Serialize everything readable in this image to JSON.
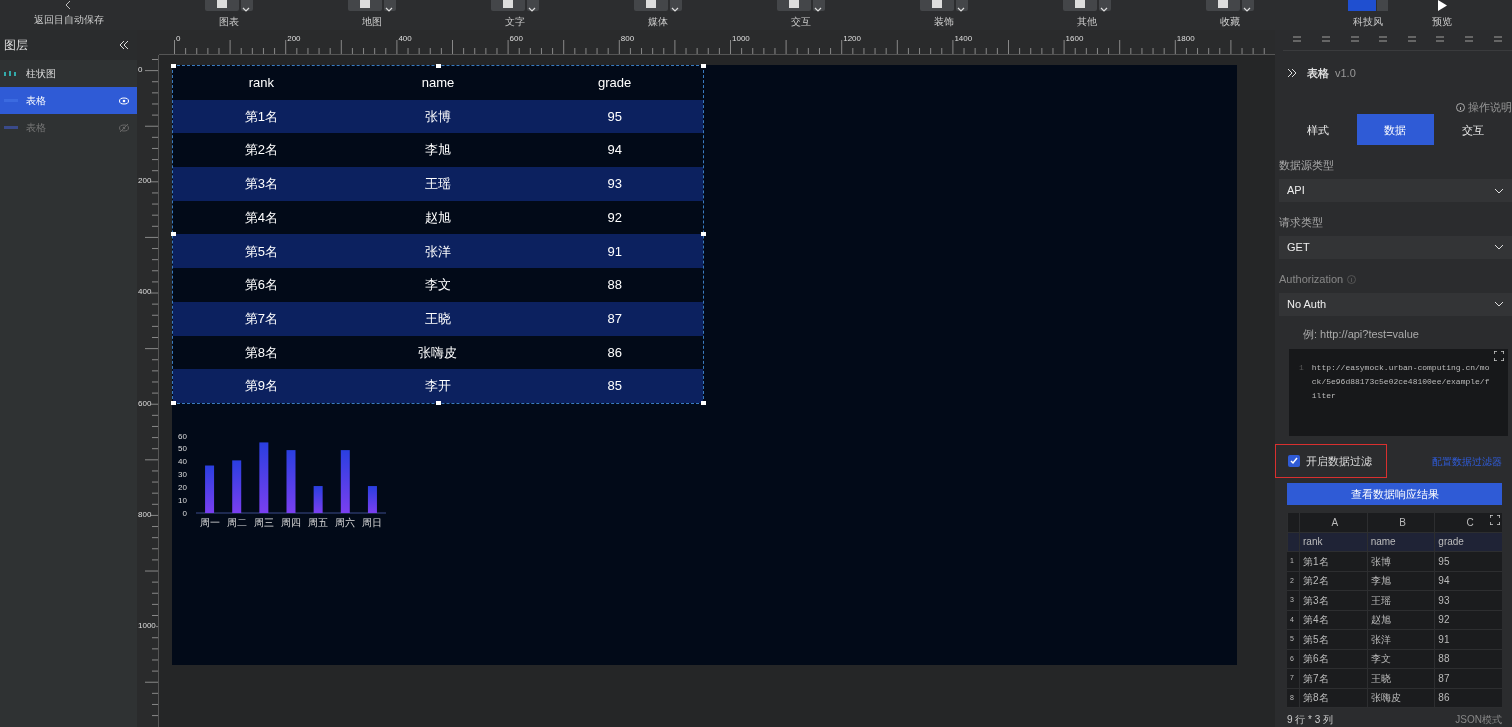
{
  "toolbar": {
    "back_label": "返回目自动保存",
    "tools": [
      {
        "label": "图表"
      },
      {
        "label": "地图"
      },
      {
        "label": "文字"
      },
      {
        "label": "媒体"
      },
      {
        "label": "交互"
      },
      {
        "label": "装饰"
      },
      {
        "label": "其他"
      },
      {
        "label": "收藏"
      }
    ],
    "theme": {
      "label": "科技风"
    },
    "preview": {
      "label": "预览"
    }
  },
  "layers": {
    "title": "图层",
    "items": [
      {
        "label": "柱状图",
        "kind": "bar",
        "selected": false,
        "hidden": false
      },
      {
        "label": "表格",
        "kind": "table",
        "selected": true,
        "hidden": false
      },
      {
        "label": "表格",
        "kind": "table",
        "selected": false,
        "hidden": true
      }
    ]
  },
  "rulers": {
    "x_labels": [
      "0",
      "200",
      "400",
      "600",
      "800",
      "1000",
      "1200",
      "1400",
      "1600",
      "1800"
    ],
    "y_labels": [
      "0",
      "200",
      "400",
      "600",
      "800",
      "1000"
    ]
  },
  "table": {
    "columns": [
      "rank",
      "name",
      "grade"
    ],
    "rows": [
      [
        "第1名",
        "张博",
        "95"
      ],
      [
        "第2名",
        "李旭",
        "94"
      ],
      [
        "第3名",
        "王瑶",
        "93"
      ],
      [
        "第4名",
        "赵旭",
        "92"
      ],
      [
        "第5名",
        "张洋",
        "91"
      ],
      [
        "第6名",
        "李文",
        "88"
      ],
      [
        "第7名",
        "王晓",
        "87"
      ],
      [
        "第8名",
        "张嗨皮",
        "86"
      ],
      [
        "第9名",
        "李开",
        "85"
      ]
    ]
  },
  "chart": {
    "chart_data": {
      "type": "bar",
      "categories": [
        "周一",
        "周二",
        "周三",
        "周四",
        "周五",
        "周六",
        "周日"
      ],
      "values": [
        37,
        41,
        55,
        49,
        21,
        49,
        21
      ],
      "ylim": [
        0,
        60
      ],
      "yticks": [
        0,
        10,
        20,
        30,
        40,
        50,
        60
      ]
    }
  },
  "panel": {
    "title": "表格",
    "version": "v1.0",
    "help": "操作说明",
    "tabs": [
      {
        "label": "样式",
        "selected": false
      },
      {
        "label": "数据",
        "selected": true
      },
      {
        "label": "交互",
        "selected": false
      }
    ],
    "fields": [
      {
        "label": "数据源类型",
        "value": "API",
        "hint": false
      },
      {
        "label": "请求类型",
        "value": "GET",
        "hint": false
      },
      {
        "label": "Authorization",
        "value": "No Auth",
        "hint": true
      }
    ],
    "url_example": "例: http://api?test=value",
    "code_line_number": "1",
    "code": "http://easymock.urban-computing.cn/mock/5e96d88173c5e02ce48100ee/example/filter",
    "filter": {
      "label": "开启数据过滤",
      "checked": true,
      "link": "配置数据过滤器"
    },
    "result_button": "查看数据响应结果",
    "sheet": {
      "letters": [
        "A",
        "B",
        "C"
      ],
      "header": [
        "rank",
        "name",
        "grade"
      ],
      "rows": [
        {
          "number": "1",
          "cells": [
            "第1名",
            "张博",
            "95"
          ]
        },
        {
          "number": "2",
          "cells": [
            "第2名",
            "李旭",
            "94"
          ]
        },
        {
          "number": "3",
          "cells": [
            "第3名",
            "王瑶",
            "93"
          ]
        },
        {
          "number": "4",
          "cells": [
            "第4名",
            "赵旭",
            "92"
          ]
        },
        {
          "number": "5",
          "cells": [
            "第5名",
            "张洋",
            "91"
          ]
        },
        {
          "number": "6",
          "cells": [
            "第6名",
            "李文",
            "88"
          ]
        },
        {
          "number": "7",
          "cells": [
            "第7名",
            "王晓",
            "87"
          ]
        },
        {
          "number": "8",
          "cells": [
            "第8名",
            "张嗨皮",
            "86"
          ]
        }
      ]
    },
    "size_note": "9 行 * 3 列",
    "mode_link": "JSON模式"
  }
}
